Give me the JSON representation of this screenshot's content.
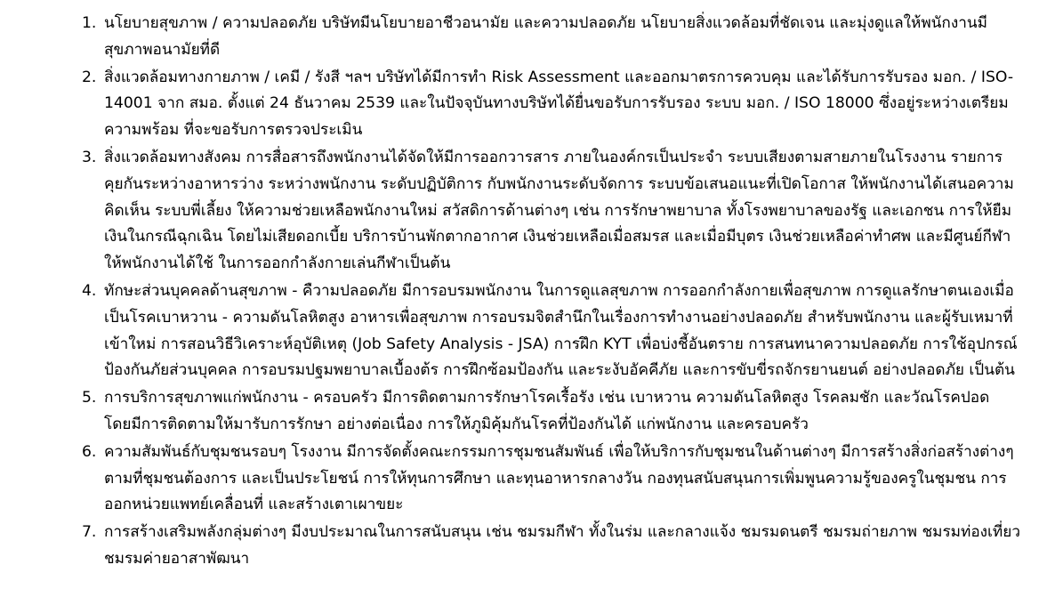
{
  "items": [
    {
      "number": "1.",
      "text": "นโยบายสุขภาพ / ความปลอดภัย บริษัทมีนโยบายอาชีวอนามัย และความปลอดภัย นโยบายสิ่งแวดล้อมที่ชัดเจน และมุ่งดูแลให้พนักงานมีสุขภาพอนามัยที่ดี"
    },
    {
      "number": "2.",
      "text": "สิ่งแวดล้อมทางกายภาพ / เคมี / รังสี ฯลฯ บริษัทได้มีการทำ Risk Assessment และออกมาตรการควบคุม และได้รับการรับรอง มอก. / ISO-14001 จาก สมอ. ตั้งแต่ 24 ธันวาคม 2539 และในปัจจุบันทางบริษัทได้ยื่นขอรับการรับรอง ระบบ มอก. / ISO 18000 ซึ่งอยู่ระหว่างเตรียมความพร้อม ที่จะขอรับการตรวจประเมิน"
    },
    {
      "number": "3.",
      "text": "สิ่งแวดล้อมทางสังคม การสื่อสารถึงพนักงานได้จัดให้มีการออกวารสาร ภายในองค์กรเป็นประจำ ระบบเสียงตามสายภายในโรงงาน รายการคุยกันระหว่างอาหารว่าง ระหว่างพนักงาน ระดับปฏิบัติการ กับพนักงานระดับจัดการ ระบบข้อเสนอแนะที่เปิดโอกาส ให้พนักงานได้เสนอความคิดเห็น ระบบพี่เลี้ยง ให้ความช่วยเหลือพนักงานใหม่ สวัสดิการด้านต่างๆ เช่น การรักษาพยาบาล ทั้งโรงพยาบาลของรัฐ และเอกชน การให้ยืมเงินในกรณีฉุกเฉิน โดยไม่เสียดอกเบี้ย บริการบ้านพักตากอากาศ เงินช่วยเหลือเมื่อสมรส และเมื่อมีบุตร เงินช่วยเหลือค่าทำศพ และมีศูนย์กีฬาให้พนักงานได้ใช้ ในการออกกำลังกายเล่นกีฬาเป็นต้น"
    },
    {
      "number": "4.",
      "text": "ทักษะส่วนบุคคลด้านสุขภาพ - คืวามปลอดภัย มีการอบรมพนักงาน ในการดูแลสุขภาพ การออกกำลังกายเพื่อสุขภาพ การดูแลรักษาตนเองเมื่อเป็นโรคเบาหวาน - ความดันโลหิตสูง อาหารเพื่อสุขภาพ การอบรมจิตสำนึกในเรื่องการทำงานอย่างปลอดภัย สำหรับพนักงาน และผู้รับเหมาที่เข้าใหม่ การสอนวิธีวิเคราะห์อุบัติเหตุ (Job Safety Analysis - JSA) การฝึก KYT เพื่อบ่งชี้อันตราย การสนทนาความปลอดภัย การใช้อุปกรณ์ป้องกันภัยส่วนบุคคล การอบรมปฐมพยาบาลเบื้องต้ร การฝึกซ้อมป้องกัน และระงับอัคคีภัย และการขับขี่รถจักรยานยนต์ อย่างปลอดภัย เป็นต้น"
    },
    {
      "number": "5.",
      "text": "การบริการสุขภาพแก่พนักงาน - ครอบครัว มีการติดตามการรักษาโรคเรื้อรัง เช่น เบาหวาน ความดันโลหิตสูง โรคลมชัก และวัณโรคปอด โดยมีการติดตามให้มารับการรักษา อย่างต่อเนื่อง การให้ภูมิคุ้มกันโรคที่ป้องกันได้ แก่พนักงาน และครอบครัว"
    },
    {
      "number": "6.",
      "text": "ความสัมพันธ์กับชุมชนรอบๆ โรงงาน มีการจัดตั้งคณะกรรมการชุมชนสัมพันธ์ เพื่อให้บริการกับชุมชนในด้านต่างๆ มีการสร้างสิ่งก่อสร้างต่างๆ ตามที่ชุมชนต้องการ และเป็นประโยชน์ การให้ทุนการศึกษา และทุนอาหารกลางวัน กองทุนสนับสนุนการเพิ่มพูนความรู้ของครูในชุมชน การออกหน่วยแพทย์เคลื่อนที่ และสร้างเตาเผาขยะ"
    },
    {
      "number": "7.",
      "text": "การสร้างเสริมพลังกลุ่มต่างๆ มีงบประมาณในการสนับสนุน เช่น ชมรมกีฬา ทั้งในร่ม และกลางแจ้ง ชมรมดนตรี ชมรมถ่ายภาพ ชมรมท่องเที่ยว ชมรมค่ายอาสาพัฒนา"
    }
  ]
}
